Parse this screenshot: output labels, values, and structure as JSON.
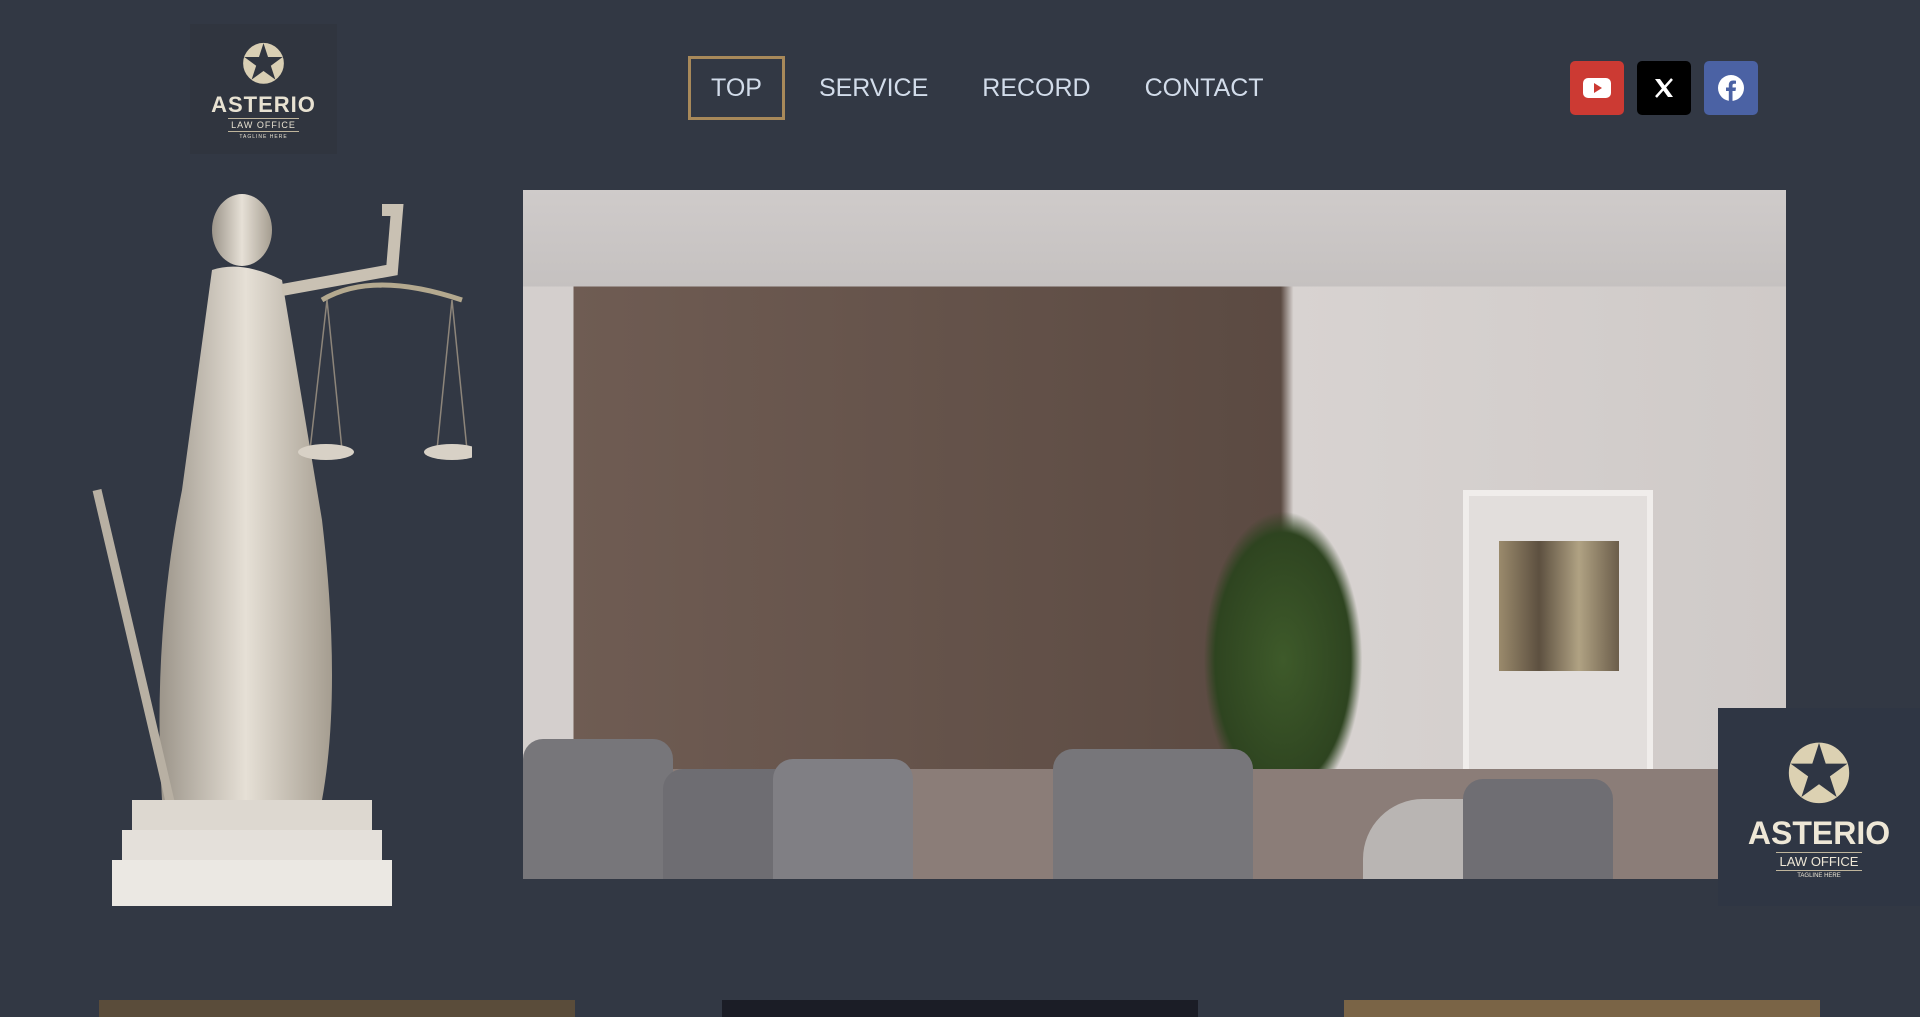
{
  "header": {
    "logo": {
      "name": "ASTERIO",
      "sub": "LAW OFFICE",
      "tagline": "TAGLINE HERE"
    },
    "nav": [
      {
        "label": "TOP",
        "active": true
      },
      {
        "label": "SERVICE"
      },
      {
        "label": "RECORD"
      },
      {
        "label": "CONTACT"
      }
    ],
    "social": [
      {
        "icon": "youtube-icon",
        "color": "#cc3a33"
      },
      {
        "icon": "x-icon",
        "color": "#000000"
      },
      {
        "icon": "facebook-icon",
        "color": "#4b62a4"
      }
    ]
  },
  "floating_logo": {
    "name": "ASTERIO",
    "sub": "LAW OFFICE",
    "tagline": "TAGLINE HERE"
  },
  "colors": {
    "background": "#323844",
    "accent": "#a8895a",
    "nav_text": "#d2dcea"
  }
}
